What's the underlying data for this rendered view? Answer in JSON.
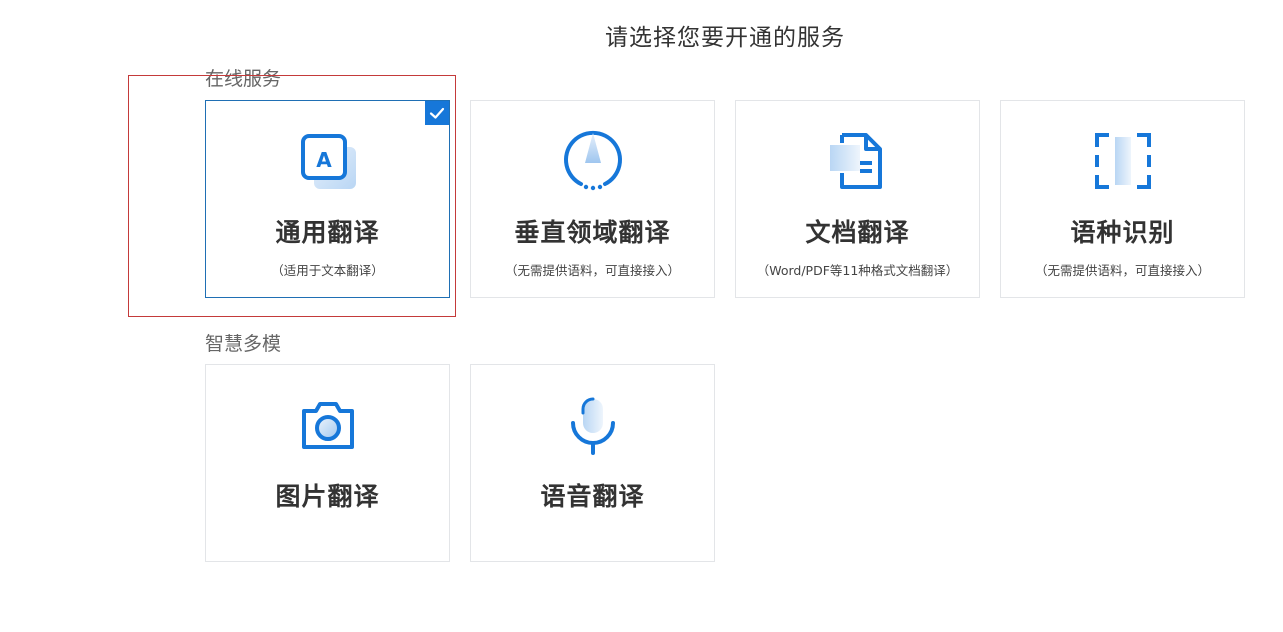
{
  "page_title": "请选择您要开通的服务",
  "sections": [
    {
      "label": "在线服务",
      "cards": [
        {
          "title": "通用翻译",
          "desc": "（适用于文本翻译）",
          "icon": "text-translate-icon",
          "selected": true
        },
        {
          "title": "垂直领域翻译",
          "desc": "（无需提供语料，可直接接入）",
          "icon": "domain-compass-icon",
          "selected": false
        },
        {
          "title": "文档翻译",
          "desc": "（Word/PDF等11种格式文档翻译）",
          "icon": "document-icon",
          "selected": false
        },
        {
          "title": "语种识别",
          "desc": "（无需提供语料，可直接接入）",
          "icon": "language-detect-icon",
          "selected": false
        }
      ]
    },
    {
      "label": "智慧多模",
      "cards": [
        {
          "title": "图片翻译",
          "desc": "",
          "icon": "camera-icon",
          "selected": false
        },
        {
          "title": "语音翻译",
          "desc": "",
          "icon": "microphone-icon",
          "selected": false
        }
      ]
    }
  ],
  "colors": {
    "accent": "#1677d9",
    "accent_light": "#cfe3f8",
    "selected_border": "#1f6fb4",
    "highlight": "#c43a3a"
  }
}
